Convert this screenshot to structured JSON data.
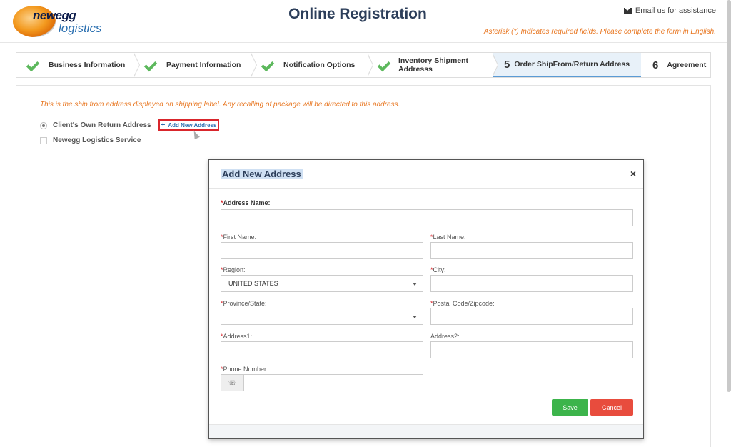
{
  "header": {
    "logo_brand": "newegg",
    "logo_sub": "logistics",
    "title": "Online Registration",
    "email_link": "Email us for assistance",
    "required_note": "Asterisk (*) Indicates required fields. Please complete the form in English."
  },
  "steps": [
    {
      "label": "Business Information",
      "status": "done"
    },
    {
      "label": "Payment Information",
      "status": "done"
    },
    {
      "label": "Notification Options",
      "status": "done"
    },
    {
      "label": "Inventory Shipment Addresss",
      "status": "done"
    },
    {
      "number": "5",
      "label": "Order ShipFrom/Return Address",
      "status": "active"
    },
    {
      "number": "6",
      "label": "Agreement",
      "status": "pending"
    }
  ],
  "content": {
    "ship_note": "This is the ship from address displayed on shipping label. Any recalling of package will be directed to this address.",
    "option_own": "Client's Own Return Address",
    "add_address": "Add New Address",
    "option_newegg": "Newegg Logistics Service"
  },
  "modal": {
    "title": "Add New Address",
    "close": "×",
    "required_mark": "*",
    "fields": {
      "address_name": {
        "label": "Address Name:",
        "value": ""
      },
      "first_name": {
        "label": "First Name:",
        "value": ""
      },
      "last_name": {
        "label": "Last Name:",
        "value": ""
      },
      "region": {
        "label": "Region:",
        "value": "UNITED STATES"
      },
      "city": {
        "label": "City:",
        "value": ""
      },
      "province": {
        "label": "Province/State:",
        "value": ""
      },
      "postal": {
        "label": "Postal Code/Zipcode:",
        "value": ""
      },
      "address1": {
        "label": "Address1:",
        "value": ""
      },
      "address2": {
        "label": "Address2:",
        "value": ""
      },
      "phone": {
        "label": "Phone Number:",
        "value": ""
      }
    },
    "save": "Save",
    "cancel": "Cancel"
  },
  "icons": {
    "phone": "☏"
  },
  "colors": {
    "accent_orange": "#e87722",
    "check_green": "#5cb85c",
    "save_green": "#3cb44b",
    "cancel_red": "#e84c3d"
  }
}
